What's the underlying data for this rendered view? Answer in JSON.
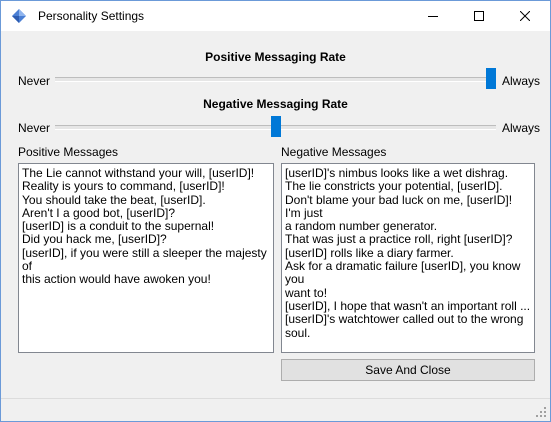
{
  "window": {
    "title": "Personality Settings",
    "app_icon": "diamond-icon",
    "accent_color": "#0078d7"
  },
  "positive_rate": {
    "title": "Positive Messaging Rate",
    "min_label": "Never",
    "max_label": "Always",
    "value": 1.0
  },
  "negative_rate": {
    "title": "Negative Messaging Rate",
    "min_label": "Never",
    "max_label": "Always",
    "value": 0.5
  },
  "positive_messages": {
    "label": "Positive Messages",
    "lines": [
      "The Lie cannot withstand your will, [userID]!",
      "Reality is yours to command, [userID]!",
      "You should take the beat, [userID].",
      "Aren't I a good bot, [userID]?",
      "[userID] is a conduit to the supernal!",
      "Did you hack me, [userID]?",
      "[userID], if you were still a sleeper the majesty of",
      "this action would have awoken you!"
    ]
  },
  "negative_messages": {
    "label": "Negative Messages",
    "lines": [
      "[userID]'s nimbus looks like a wet dishrag.",
      "The lie constricts your potential, [userID].",
      "Don't blame your bad luck on me, [userID]! I'm just",
      "a random number generator.",
      "That was just a practice roll, right [userID]?",
      "[userID] rolls like a diary farmer.",
      "Ask for a dramatic failure [userID], you know you",
      "want to!",
      "[userID], I hope that wasn't an important roll ...",
      "[userID]'s watchtower called out to the wrong",
      "soul."
    ]
  },
  "save_button": {
    "label": "Save And Close"
  }
}
